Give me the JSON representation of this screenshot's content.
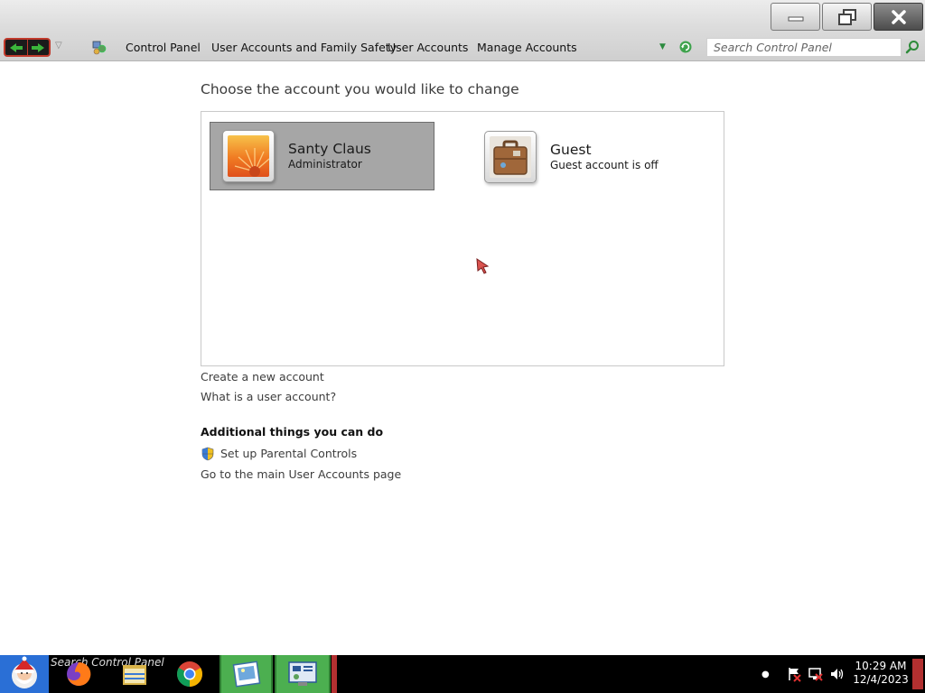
{
  "window": {
    "breadcrumb": [
      "Control Panel",
      "User Accounts and Family Safety",
      "User Accounts",
      "Manage Accounts"
    ],
    "search_placeholder": "Search Control Panel"
  },
  "main": {
    "heading": "Choose the account you would like to change",
    "accounts": [
      {
        "name": "Santy Claus",
        "role": "Administrator",
        "selected": true
      },
      {
        "name": "Guest",
        "role": "Guest account is off",
        "selected": false
      }
    ],
    "links": [
      "Create a new account",
      "What is a user account?"
    ],
    "additional": {
      "title": "Additional things you can do",
      "items": [
        "Set up Parental Controls",
        "Go to the main User Accounts page"
      ]
    }
  },
  "taskbar": {
    "search_text": "Search  Control Panel",
    "time": "10:29 AM",
    "date": "12/4/2023"
  },
  "colors": {
    "selected_tile": "#a6a6a6",
    "taskbar": "#000000",
    "active_task": "#4caf50",
    "accent_red": "#b23030"
  }
}
